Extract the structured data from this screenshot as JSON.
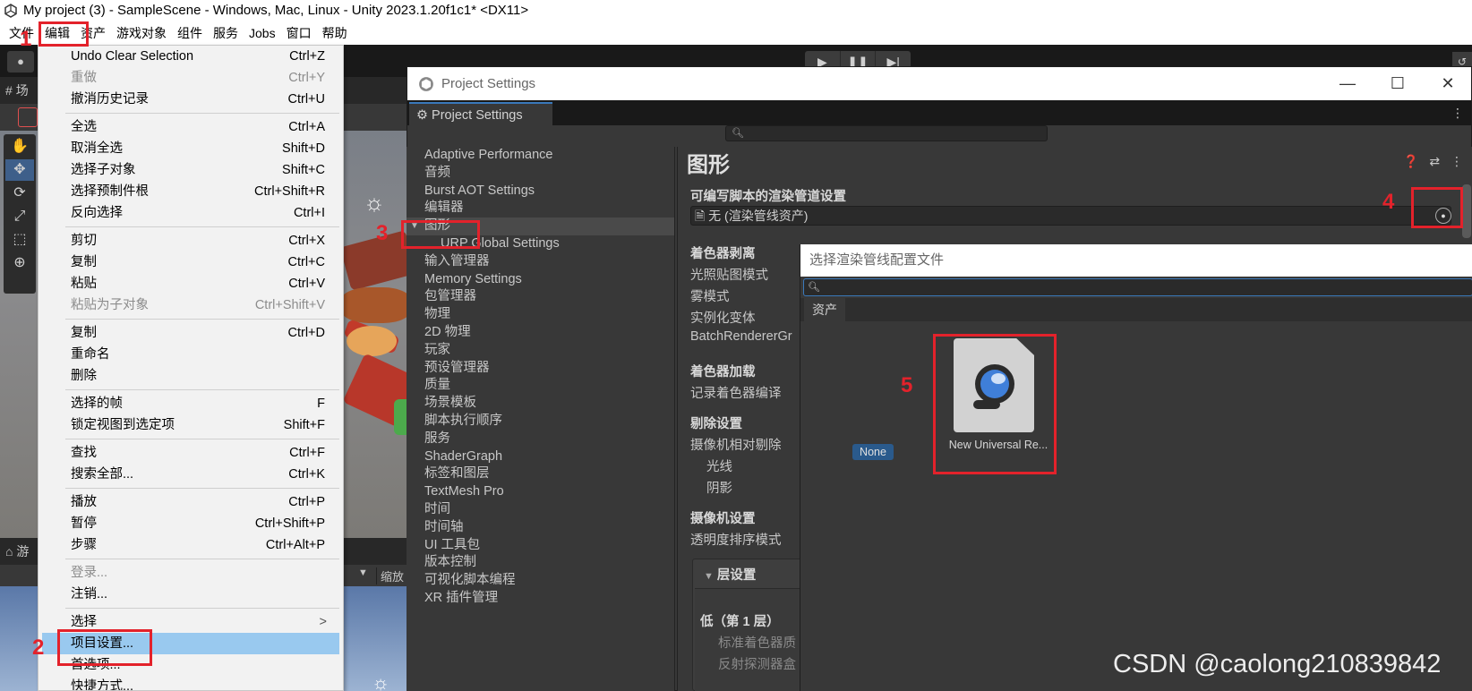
{
  "window": {
    "title": "My project (3) - SampleScene - Windows, Mac, Linux - Unity 2023.1.20f1c1* <DX11>"
  },
  "menubar": [
    "文件",
    "编辑",
    "资产",
    "游戏对象",
    "组件",
    "服务",
    "Jobs",
    "窗口",
    "帮助"
  ],
  "left_panels": {
    "scene_tab": "场",
    "game_tab": "游",
    "scale_label": "缩放"
  },
  "edit_menu": {
    "items": [
      {
        "label": "Undo Clear Selection",
        "shortcut": "Ctrl+Z"
      },
      {
        "label": "重做",
        "shortcut": "Ctrl+Y",
        "disabled": true
      },
      {
        "label": "撤消历史记录",
        "shortcut": "Ctrl+U"
      },
      {
        "label": "全选",
        "shortcut": "Ctrl+A"
      },
      {
        "label": "取消全选",
        "shortcut": "Shift+D"
      },
      {
        "label": "选择子对象",
        "shortcut": "Shift+C"
      },
      {
        "label": "选择预制件根",
        "shortcut": "Ctrl+Shift+R"
      },
      {
        "label": "反向选择",
        "shortcut": "Ctrl+I"
      },
      {
        "label": "剪切",
        "shortcut": "Ctrl+X"
      },
      {
        "label": "复制",
        "shortcut": "Ctrl+C"
      },
      {
        "label": "粘贴",
        "shortcut": "Ctrl+V"
      },
      {
        "label": "粘贴为子对象",
        "shortcut": "Ctrl+Shift+V",
        "disabled": true
      },
      {
        "label": "复制",
        "shortcut": "Ctrl+D"
      },
      {
        "label": "重命名",
        "shortcut": ""
      },
      {
        "label": "删除",
        "shortcut": ""
      },
      {
        "label": "选择的帧",
        "shortcut": "F"
      },
      {
        "label": "锁定视图到选定项",
        "shortcut": "Shift+F"
      },
      {
        "label": "查找",
        "shortcut": "Ctrl+F"
      },
      {
        "label": "搜索全部...",
        "shortcut": "Ctrl+K"
      },
      {
        "label": "播放",
        "shortcut": "Ctrl+P"
      },
      {
        "label": "暂停",
        "shortcut": "Ctrl+Shift+P"
      },
      {
        "label": "步骤",
        "shortcut": "Ctrl+Alt+P"
      },
      {
        "label": "登录...",
        "shortcut": "",
        "disabled": true
      },
      {
        "label": "注销...",
        "shortcut": ""
      },
      {
        "label": "选择",
        "shortcut": ""
      },
      {
        "label": "项目设置...",
        "shortcut": ""
      },
      {
        "label": "首选项...",
        "shortcut": ""
      },
      {
        "label": "快捷方式...",
        "shortcut": ""
      }
    ],
    "submenu_arrow": ">"
  },
  "project_settings": {
    "window_title": "Project Settings",
    "tab_label": "Project Settings",
    "nav": [
      "Adaptive Performance",
      "音频",
      "Burst AOT Settings",
      "编辑器",
      "图形",
      "URP Global Settings",
      "输入管理器",
      "Memory Settings",
      "包管理器",
      "物理",
      "2D 物理",
      "玩家",
      "预设管理器",
      "质量",
      "场景模板",
      "脚本执行顺序",
      "服务",
      "ShaderGraph",
      "标签和图层",
      "TextMesh Pro",
      "时间",
      "时间轴",
      "UI 工具包",
      "版本控制",
      "可视化脚本编程",
      "XR 插件管理"
    ],
    "content": {
      "title": "图形",
      "srp_header": "可编写脚本的渲染管道设置",
      "pipeline_value": "无 (渲染管线资产)",
      "shader_stripping_header": "着色器剥离",
      "lightmap_modes": "光照贴图模式",
      "fog_modes": "雾模式",
      "instancing_variants": "实例化变体",
      "batch_renderer": "BatchRendererGr",
      "shader_loading_header": "着色器加载",
      "log_shader_compile": "记录着色器编译",
      "culling_header": "剔除设置",
      "camera_relative_culling": "摄像机相对剔除",
      "lights": "光线",
      "shadows": "阴影",
      "camera_settings_header": "摄像机设置",
      "transparency_sort": "透明度排序模式",
      "tier_settings": "层设置",
      "low_tier": "低（第 1 层）",
      "standard_shader_quality": "标准着色器质",
      "reflection_probes": "反射探测器盒"
    }
  },
  "picker": {
    "title": "选择渲染管线配置文件",
    "tab_assets": "资产",
    "none_label": "None",
    "asset_label": "New Universal Re..."
  },
  "annotations": [
    "1",
    "2",
    "3",
    "4",
    "5"
  ],
  "watermark": "CSDN @caolong210839842",
  "colors": {
    "annotation": "#e3222b",
    "selection": "#99c9ef",
    "unity_accent": "#3a79bb"
  }
}
